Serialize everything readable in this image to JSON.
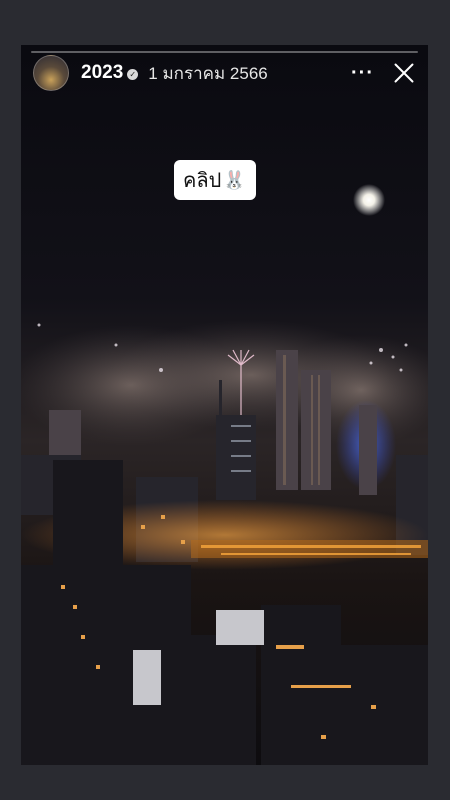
{
  "story": {
    "username": "2023",
    "date": "1 มกราคม 2566",
    "more_label": "···",
    "sticker_text": "คลิป",
    "sticker_emoji": "🐰",
    "icons": [
      "verified-icon",
      "more-icon",
      "close-icon",
      "bunny-emoji-icon"
    ]
  },
  "colors": {
    "background": "#2a2b31",
    "night_sky": "#0b0b12",
    "city_light": "#f2a23a",
    "fireworks": "#e9c9d6"
  }
}
